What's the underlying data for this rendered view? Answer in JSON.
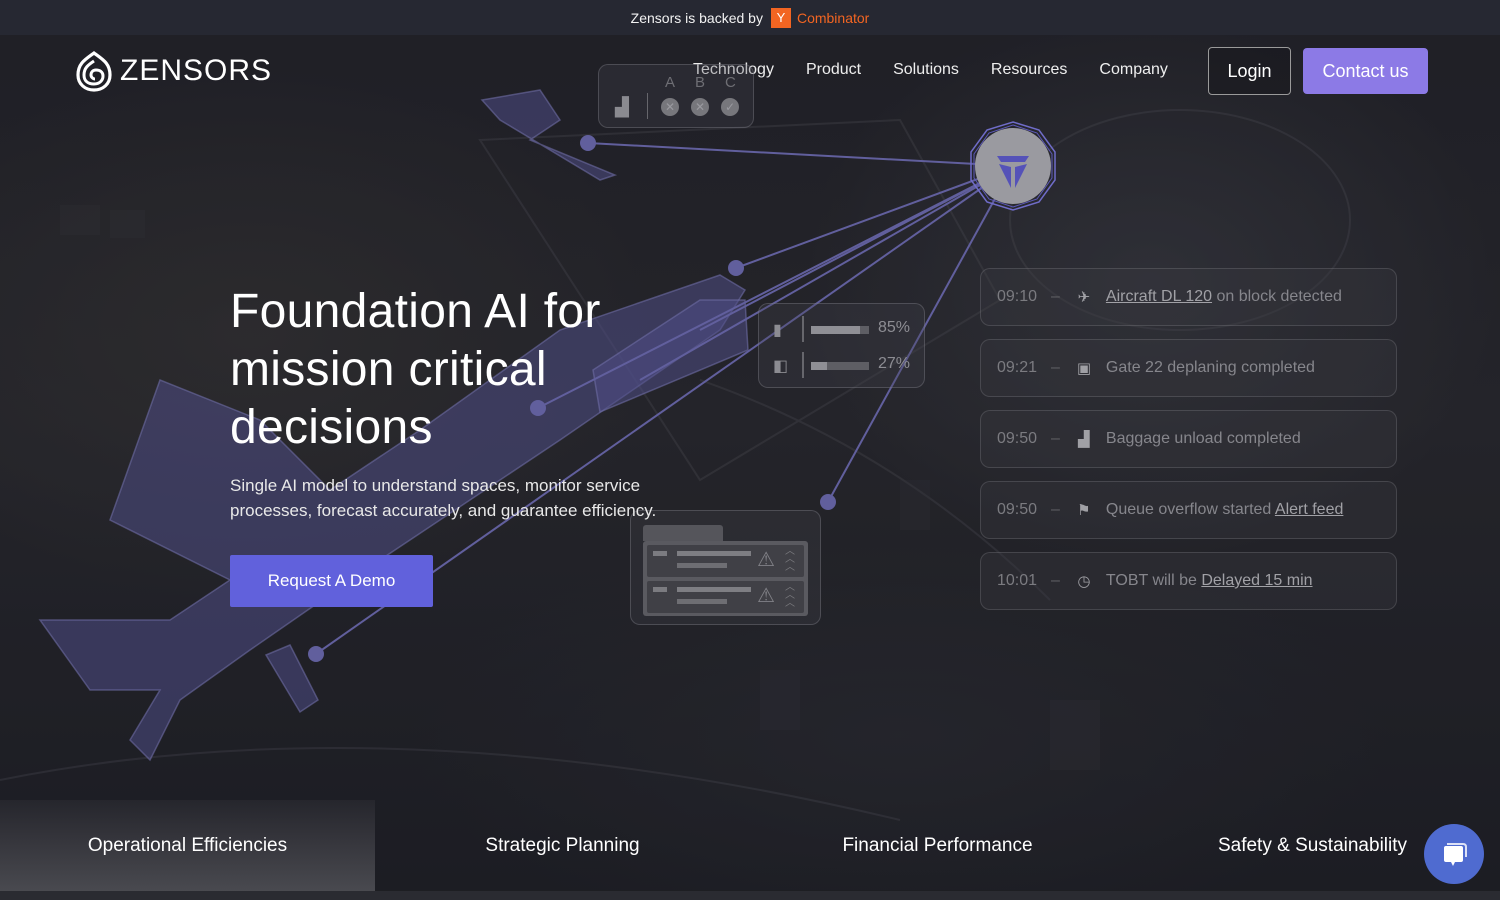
{
  "announcement": {
    "prefix": "Zensors is backed by",
    "yc_letter": "Y",
    "yc_name": "Combinator"
  },
  "header": {
    "logo_text": "ZENSORS",
    "nav": [
      "Technology",
      "Product",
      "Solutions",
      "Resources",
      "Company"
    ],
    "login_label": "Login",
    "contact_label": "Contact us"
  },
  "hero": {
    "headline_lines": [
      "Foundation AI for",
      "mission critical",
      "decisions"
    ],
    "subtext_lines": [
      "Single AI model to understand spaces, monitor service",
      "processes, forecast accurately, and guarantee efficiency."
    ],
    "cta_label": "Request A Demo"
  },
  "overlays": {
    "checklist": {
      "labels": [
        "A",
        "B",
        "C"
      ],
      "states": [
        "fail",
        "fail",
        "pass"
      ]
    },
    "door_status": [
      {
        "icon": "door-closed-icon",
        "percent": 85,
        "label": "85%"
      },
      {
        "icon": "door-open-icon",
        "percent": 27,
        "label": "27%"
      }
    ],
    "alert_rows": 2
  },
  "events": [
    {
      "time": "09:10",
      "icon": "aircraft-icon",
      "link": "Aircraft DL 120",
      "text": " on block detected",
      "link_first": true
    },
    {
      "time": "09:21",
      "icon": "gate-icon",
      "link": "",
      "text": "Gate 22 deplaning completed",
      "link_first": false
    },
    {
      "time": "09:50",
      "icon": "baggage-icon",
      "link": "",
      "text": "Baggage unload completed",
      "link_first": false
    },
    {
      "time": "09:50",
      "icon": "queue-icon",
      "link": "Alert feed",
      "text": "Queue overflow started ",
      "link_first": false
    },
    {
      "time": "10:01",
      "icon": "clock-icon",
      "link": "Delayed 15 min",
      "text": "TOBT will be ",
      "link_first": false
    }
  ],
  "tabs": [
    {
      "label": "Operational Efficiencies",
      "active": true
    },
    {
      "label": "Strategic Planning",
      "active": false
    },
    {
      "label": "Financial Performance",
      "active": false
    },
    {
      "label": "Safety & Sustainability",
      "active": false
    }
  ],
  "colors": {
    "accent": "#6161dc",
    "contact": "#8c7ae6",
    "yc_orange": "#f26522",
    "overlay_line": "#7b78c9",
    "chat": "#4f6bd0"
  }
}
